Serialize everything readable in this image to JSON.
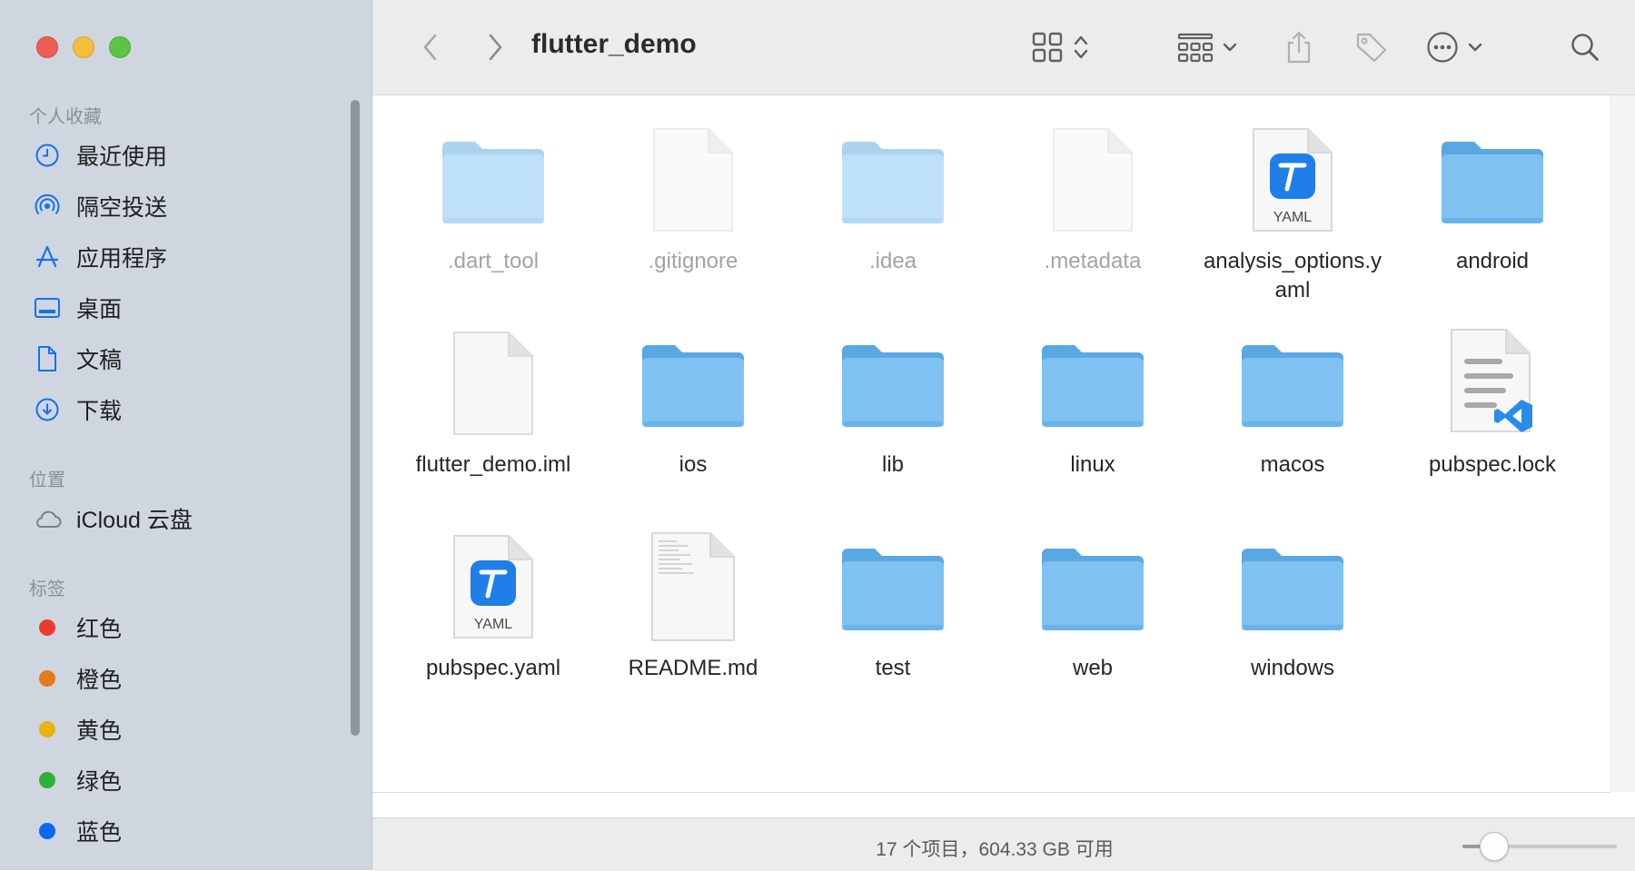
{
  "window": {
    "title": "flutter_demo"
  },
  "sidebar": {
    "favorites_title": "个人收藏",
    "favorites": [
      {
        "label": "最近使用",
        "icon": "clock-icon"
      },
      {
        "label": "隔空投送",
        "icon": "airdrop-icon"
      },
      {
        "label": "应用程序",
        "icon": "applications-icon"
      },
      {
        "label": "桌面",
        "icon": "desktop-icon"
      },
      {
        "label": "文稿",
        "icon": "document-icon"
      },
      {
        "label": "下载",
        "icon": "download-icon"
      }
    ],
    "locations_title": "位置",
    "locations": [
      {
        "label": "iCloud 云盘",
        "icon": "cloud-icon"
      }
    ],
    "tags_title": "标签",
    "tags": [
      {
        "label": "红色",
        "color": "#ea3b33"
      },
      {
        "label": "橙色",
        "color": "#e57a17"
      },
      {
        "label": "黄色",
        "color": "#e8b20f"
      },
      {
        "label": "绿色",
        "color": "#2db13c"
      },
      {
        "label": "蓝色",
        "color": "#0a67f5"
      }
    ]
  },
  "files": [
    {
      "name": ".dart_tool",
      "kind": "folder",
      "hidden": true
    },
    {
      "name": ".gitignore",
      "kind": "blank-file",
      "hidden": true
    },
    {
      "name": ".idea",
      "kind": "folder",
      "hidden": true
    },
    {
      "name": ".metadata",
      "kind": "blank-file",
      "hidden": true
    },
    {
      "name": "analysis_options.yaml",
      "kind": "yaml-file",
      "hidden": false,
      "badge": "YAML"
    },
    {
      "name": "android",
      "kind": "folder",
      "hidden": false
    },
    {
      "name": "flutter_demo.iml",
      "kind": "blank-file",
      "hidden": false
    },
    {
      "name": "ios",
      "kind": "folder",
      "hidden": false
    },
    {
      "name": "lib",
      "kind": "folder",
      "hidden": false
    },
    {
      "name": "linux",
      "kind": "folder",
      "hidden": false
    },
    {
      "name": "macos",
      "kind": "folder",
      "hidden": false
    },
    {
      "name": "pubspec.lock",
      "kind": "vscode-file",
      "hidden": false
    },
    {
      "name": "pubspec.yaml",
      "kind": "yaml-file",
      "hidden": false,
      "badge": "YAML"
    },
    {
      "name": "README.md",
      "kind": "text-file",
      "hidden": false
    },
    {
      "name": "test",
      "kind": "folder",
      "hidden": false
    },
    {
      "name": "web",
      "kind": "folder",
      "hidden": false
    },
    {
      "name": "windows",
      "kind": "folder",
      "hidden": false
    }
  ],
  "status": {
    "text": "17 个项目，604.33 GB 可用",
    "icon_size_level": 0.2
  },
  "colors": {
    "folder": "#7fc2f2",
    "folder_tab": "#5aa8e3",
    "accent": "#0a67f5"
  }
}
